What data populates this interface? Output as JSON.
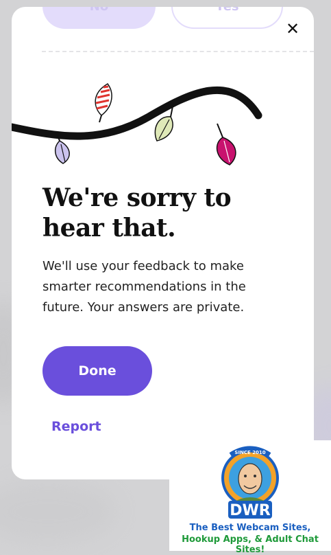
{
  "dialog": {
    "top_buttons": {
      "no_label": "No",
      "yes_label": "Yes"
    },
    "close_icon": "close-icon",
    "title_line1": "We're sorry to",
    "title_line2": "hear that.",
    "message_line1": "We'll use your feedback to make",
    "message_line2": "smarter recommendations in the",
    "message_line3": "future. Your answers are private.",
    "done_label": "Done",
    "report_label": "Report"
  },
  "watermark": {
    "since": "SINCE 2010",
    "logo_text": "DWR",
    "tagline1": "The Best Webcam Sites,",
    "tagline2": "Hookup Apps, & Adult Chat Sites!"
  },
  "colors": {
    "accent": "#6a4fdc",
    "accent_light": "#e3dcfb",
    "background": "#d3d3d5",
    "leaf_red": "#e0342f",
    "leaf_green": "#dfe9b8",
    "leaf_lavender": "#cbc3ee",
    "leaf_magenta": "#c8126e"
  }
}
